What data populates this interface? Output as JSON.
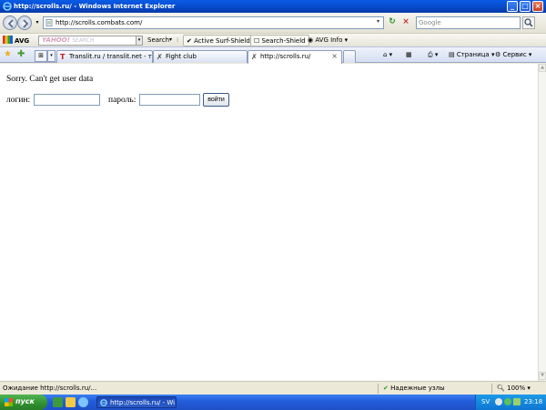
{
  "window": {
    "title": "http://scrolls.ru/ - Windows Internet Explorer",
    "minimize": "_",
    "maximize": "□",
    "close": "×"
  },
  "address_bar": {
    "url": "http://scrolls.combats.com/",
    "dropdown": "▾",
    "refresh": "↻",
    "stop": "×"
  },
  "search": {
    "placeholder": "Google"
  },
  "avg_toolbar": {
    "logo": "AVG",
    "search_engine_text": "YAHOO!",
    "search_engine_sub": "SEARCH",
    "search_button": "Search",
    "active_shield": "Active  Surf-Shield",
    "search_shield": "Search-Shield",
    "info": "AVG Info"
  },
  "tabs": [
    {
      "label": "Translit.ru / translit.net - тра...",
      "icon": "translit-icon",
      "active": false
    },
    {
      "label": "Fight club",
      "icon": "fightclub-icon",
      "active": false
    },
    {
      "label": "http://scrolls.ru/",
      "icon": "page-icon",
      "active": true
    }
  ],
  "command_bar": {
    "page": "Страница",
    "tools": "Сервис"
  },
  "content": {
    "message": "Sorry. Can't get user data",
    "login_label": "логин:",
    "password_label": "пароль:",
    "login_value": "",
    "password_value": "",
    "submit_label": "войти"
  },
  "status": {
    "text": "Ожидание http://scrolls.ru/...",
    "zone": "Надежные узлы",
    "zoom": "100%"
  },
  "taskbar": {
    "start": "пуск",
    "task": "http://scrolls.ru/ - Wi...",
    "lang": "SV",
    "clock": "23:18"
  },
  "colors": {
    "titlebar": "#0848c8",
    "taskbar": "#245edb",
    "start": "#2f8f2f"
  }
}
